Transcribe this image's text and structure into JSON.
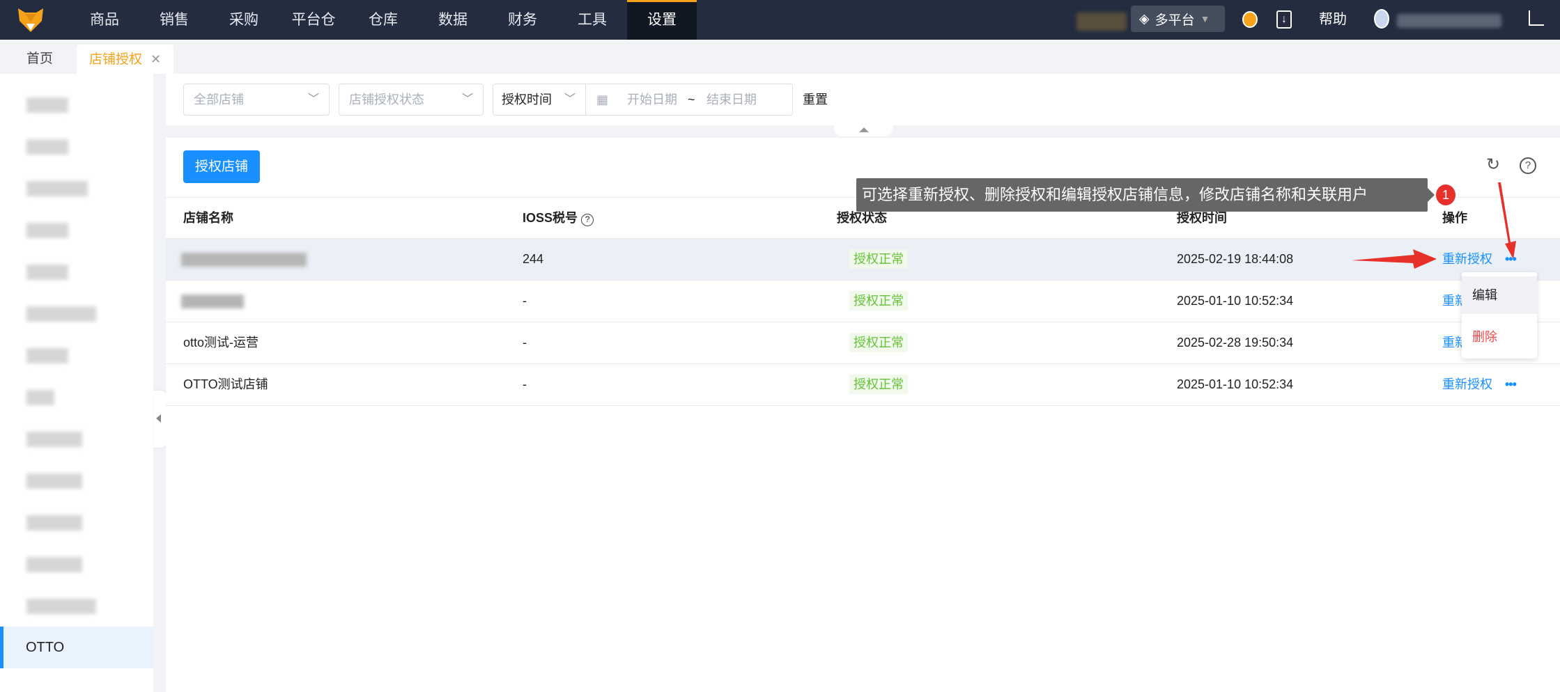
{
  "nav": {
    "items": [
      "商品",
      "销售",
      "采购",
      "平台仓",
      "仓库",
      "数据",
      "财务",
      "工具",
      "设置"
    ],
    "active": "设置",
    "platform": "多平台",
    "help": "帮助"
  },
  "tabs": {
    "home": "首页",
    "active": "店铺授权"
  },
  "sidebar": {
    "active_item": "OTTO"
  },
  "filters": {
    "store_placeholder": "全部店铺",
    "status_placeholder": "店铺授权状态",
    "time_type": "授权时间",
    "start_placeholder": "开始日期",
    "separator": "~",
    "end_placeholder": "结束日期",
    "reset": "重置"
  },
  "toolbar": {
    "authorize_button": "授权店铺"
  },
  "table": {
    "headers": [
      "店铺名称",
      "IOSS税号",
      "授权状态",
      "授权时间",
      "操作"
    ],
    "rows": [
      {
        "name": "",
        "ioss": "244",
        "status": "授权正常",
        "time": "2025-02-19 18:44:08",
        "action": "重新授权"
      },
      {
        "name": "",
        "ioss": "-",
        "status": "授权正常",
        "time": "2025-01-10 10:52:34",
        "action": "重新授权"
      },
      {
        "name": "otto测试-运营",
        "ioss": "-",
        "status": "授权正常",
        "time": "2025-02-28 19:50:34",
        "action": "重新授权"
      },
      {
        "name": "OTTO测试店铺",
        "ioss": "-",
        "status": "授权正常",
        "time": "2025-01-10 10:52:34",
        "action": "重新授权"
      }
    ],
    "more": "•••"
  },
  "dropdown": {
    "edit": "编辑",
    "delete": "删除"
  },
  "tooltip": {
    "text": "可选择重新授权、删除授权和编辑授权店铺信息，修改店铺名称和关联用户",
    "step": "1"
  },
  "colors": {
    "accent": "#1890ff",
    "brand": "#f7a21b",
    "topbar": "#232d3f",
    "success": "#67c23a",
    "danger": "#f04848",
    "annotation": "#e8302a"
  }
}
